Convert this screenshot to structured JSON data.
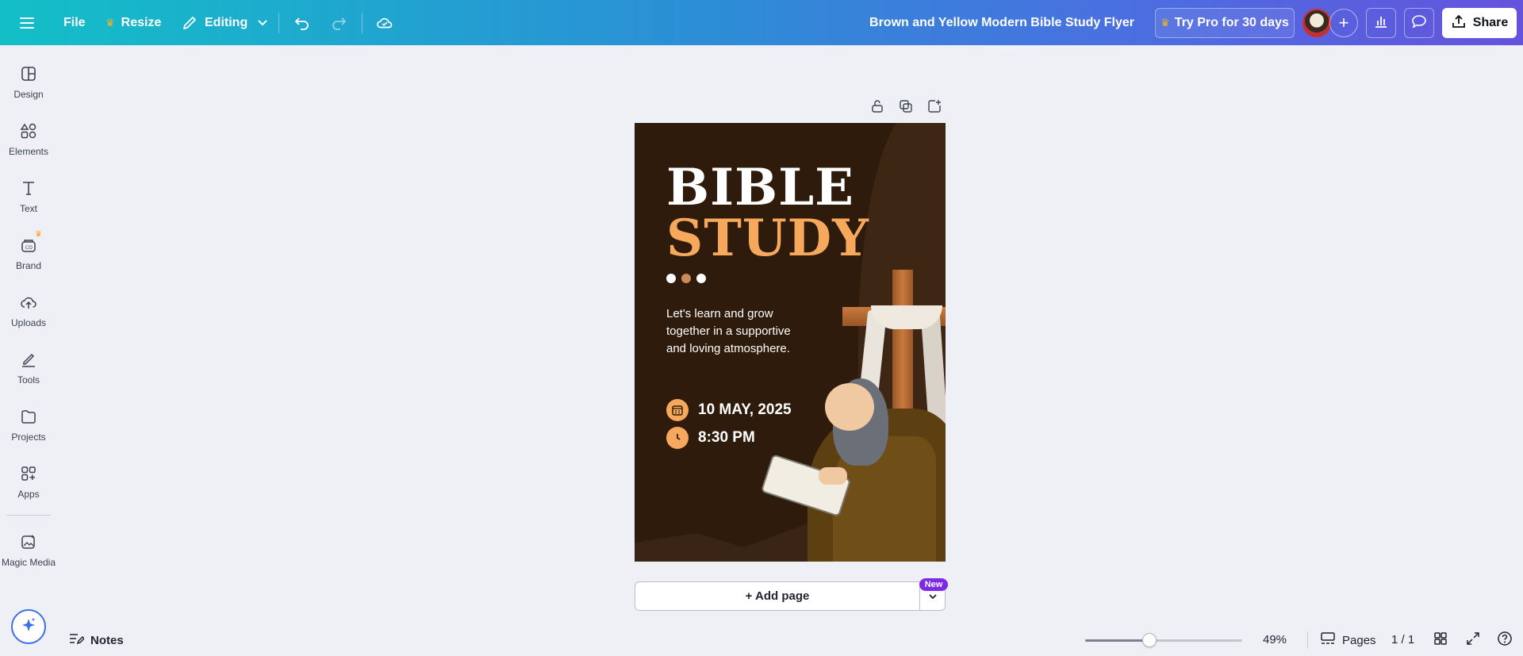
{
  "topbar": {
    "file_label": "File",
    "resize_label": "Resize",
    "editing_label": "Editing",
    "doc_title": "Brown and Yellow Modern Bible Study Flyer",
    "pro_label": "Try Pro for 30 days",
    "share_label": "Share",
    "gradient_start": "#13bfc7",
    "gradient_end": "#6553dd"
  },
  "sidebar": {
    "items": [
      {
        "label": "Design",
        "icon": "design-icon"
      },
      {
        "label": "Elements",
        "icon": "elements-icon"
      },
      {
        "label": "Text",
        "icon": "text-icon"
      },
      {
        "label": "Brand",
        "icon": "brand-icon"
      },
      {
        "label": "Uploads",
        "icon": "uploads-icon"
      },
      {
        "label": "Tools",
        "icon": "tools-icon"
      },
      {
        "label": "Projects",
        "icon": "projects-icon"
      },
      {
        "label": "Apps",
        "icon": "apps-icon"
      },
      {
        "label": "Magic Media",
        "icon": "magic-media-icon"
      }
    ]
  },
  "flyer": {
    "title_line1": "BIBLE",
    "title_line2": "STUDY",
    "description": "Let's learn and grow together in a supportive and loving atmosphere.",
    "date": "10 MAY, 2025",
    "time": "8:30 PM",
    "background_color": "#2f1b0b",
    "accent_color": "#f6a95c",
    "dot_colors": [
      "#ffffff",
      "#c98a5c",
      "#ffffff"
    ]
  },
  "canvas": {
    "add_page_label": "+ Add page",
    "new_badge": "New"
  },
  "bottombar": {
    "notes_label": "Notes",
    "zoom_percent": 49,
    "zoom_label": "49%",
    "pages_label": "Pages",
    "page_indicator": "1 / 1"
  }
}
